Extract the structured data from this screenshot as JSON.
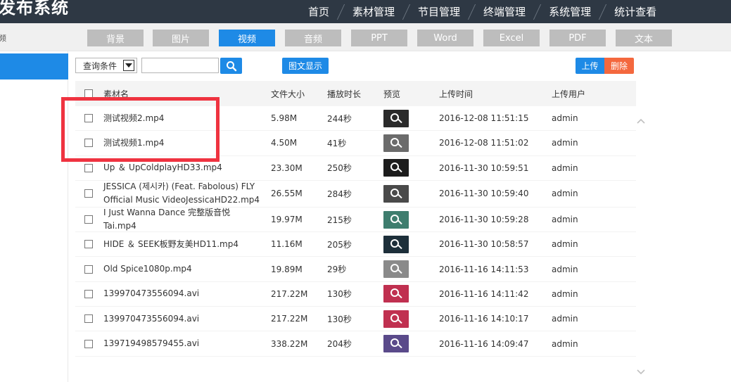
{
  "header": {
    "title": "发布系统",
    "nav": [
      "首页",
      "素材管理",
      "节目管理",
      "终端管理",
      "系统管理",
      "统计查看"
    ]
  },
  "left_label": "频",
  "tabs": [
    {
      "label": "背景",
      "active": false
    },
    {
      "label": "图片",
      "active": false
    },
    {
      "label": "视频",
      "active": true
    },
    {
      "label": "音频",
      "active": false
    },
    {
      "label": "PPT",
      "active": false
    },
    {
      "label": "Word",
      "active": false
    },
    {
      "label": "Excel",
      "active": false
    },
    {
      "label": "PDF",
      "active": false
    },
    {
      "label": "文本",
      "active": false
    }
  ],
  "toolbar": {
    "query_select": "查询条件",
    "search_value": "",
    "view_toggle_label": "图文显示",
    "upload_label": "上传",
    "delete_label": "删除"
  },
  "table": {
    "columns": [
      "素材名",
      "文件大小",
      "播放时长",
      "预览",
      "上传时间",
      "上传用户"
    ],
    "rows": [
      {
        "name": "测试视频2.mp4",
        "size": "5.98M",
        "duration": "244秒",
        "time": "2016-12-08 11:51:15",
        "user": "admin",
        "thumb": "#2a2a2a"
      },
      {
        "name": "测试视频1.mp4",
        "size": "4.50M",
        "duration": "41秒",
        "time": "2016-12-08 11:51:02",
        "user": "admin",
        "thumb": "#6b6b6b"
      },
      {
        "name": "Up ＆ UpColdplayHD33.mp4",
        "size": "23.30M",
        "duration": "250秒",
        "time": "2016-11-30 10:59:51",
        "user": "admin",
        "thumb": "#1c1c1c"
      },
      {
        "name": "JESSICA (제시카) (Feat. Fabolous) FLY Official Music VideoJessicaHD22.mp4",
        "size": "26.55M",
        "duration": "284秒",
        "time": "2016-11-30 10:59:40",
        "user": "admin",
        "thumb": "#4a4a4a"
      },
      {
        "name": "I Just Wanna Dance 完整版音悦Tai.mp4",
        "size": "19.97M",
        "duration": "215秒",
        "time": "2016-11-30 10:59:28",
        "user": "admin",
        "thumb": "#3e7d6e"
      },
      {
        "name": "HIDE ＆ SEEK板野友美HD11.mp4",
        "size": "11.16M",
        "duration": "205秒",
        "time": "2016-11-30 10:58:57",
        "user": "admin",
        "thumb": "#1d2f3a"
      },
      {
        "name": "Old Spice1080p.mp4",
        "size": "19.89M",
        "duration": "29秒",
        "time": "2016-11-16 14:11:53",
        "user": "admin",
        "thumb": "#8a8a8a"
      },
      {
        "name": "139970473556094.avi",
        "size": "217.22M",
        "duration": "130秒",
        "time": "2016-11-16 14:11:42",
        "user": "admin",
        "thumb": "#c03050"
      },
      {
        "name": "139970473556094.avi",
        "size": "217.22M",
        "duration": "130秒",
        "time": "2016-11-16 14:10:17",
        "user": "admin",
        "thumb": "#c03050"
      },
      {
        "name": "139719498579455.avi",
        "size": "338.22M",
        "duration": "204秒",
        "time": "2016-11-16 14:09:47",
        "user": "admin",
        "thumb": "#5a4a8a"
      }
    ]
  },
  "colors": {
    "header": "#2e3844",
    "accent": "#1e8ae6",
    "danger": "#f4683e",
    "highlight": "#ef3340"
  }
}
